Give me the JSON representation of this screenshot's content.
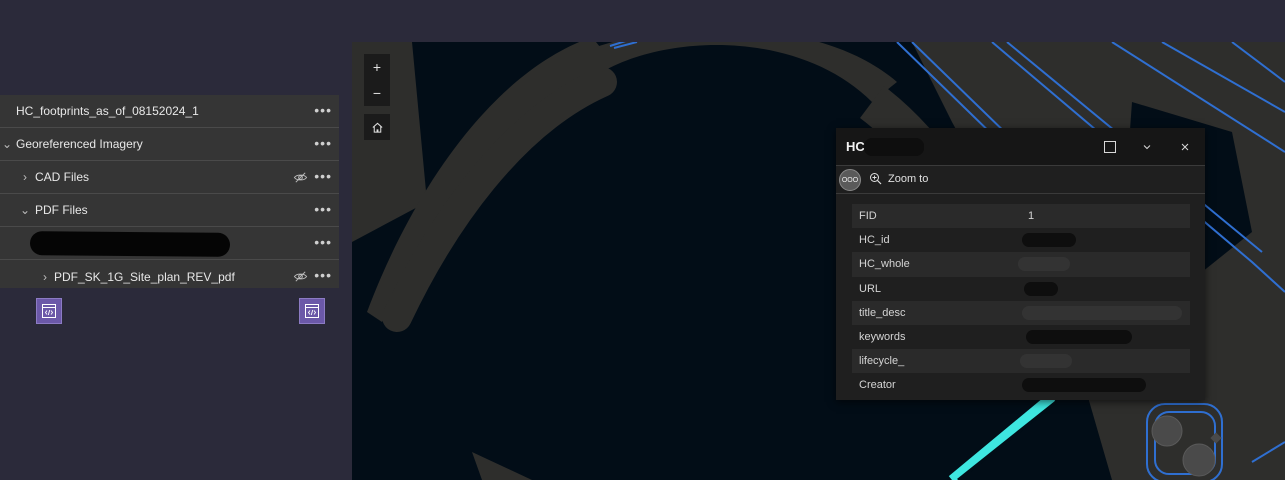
{
  "layers": {
    "items": [
      {
        "label": "HC_footprints_as_of_08152024_1",
        "chevron": "",
        "more": "•••"
      },
      {
        "label": "Georeferenced Imagery",
        "chevron": "⌄",
        "more": "•••"
      },
      {
        "label": "CAD Files",
        "chevron": "›",
        "more": "•••"
      },
      {
        "label": "PDF Files",
        "chevron": "⌄",
        "more": "•••"
      },
      {
        "label": "",
        "chevron": "",
        "more": "•••"
      },
      {
        "label": "PDF_SK_1G_Site_plan_REV_pdf",
        "chevron": "›",
        "more": "•••"
      }
    ]
  },
  "map_tools": {
    "zoom_in": "+",
    "zoom_out": "−"
  },
  "popup": {
    "title": "HC",
    "zoom_to_label": "Zoom to",
    "multi_label": "OOO",
    "attributes": [
      {
        "key": "FID",
        "value": "1"
      },
      {
        "key": "HC_id",
        "value": ""
      },
      {
        "key": "HC_whole",
        "value": ""
      },
      {
        "key": "URL",
        "value": ""
      },
      {
        "key": "title_desc",
        "value": ""
      },
      {
        "key": "keywords",
        "value": ""
      },
      {
        "key": "lifecycle_",
        "value": ""
      },
      {
        "key": "Creator",
        "value": ""
      }
    ]
  },
  "colors": {
    "accent": "#6b58a8",
    "road_outline": "#2f6fd1",
    "highlight": "#3ee6e0",
    "land": "#2e2e2c",
    "water": "#020d17"
  }
}
